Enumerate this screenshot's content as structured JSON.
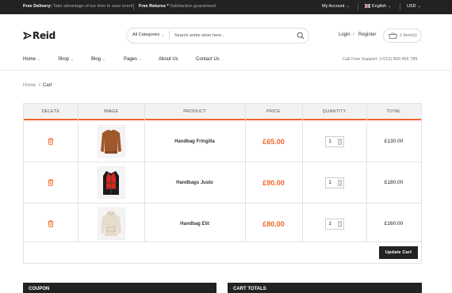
{
  "topbar": {
    "delivery_label": "Free Delivery:",
    "delivery_text": "Take advantage of our time to save event",
    "returns_label": "Free Returns *",
    "returns_text": "Satisfaction guaranteed",
    "account": "My Account",
    "language": "English",
    "currency": "USD"
  },
  "header": {
    "logo": "Reid",
    "search_category": "All Categories",
    "search_placeholder": "Search entire store here..",
    "login": "Login",
    "register": "Register",
    "account_sep": "/",
    "cart_count": "2 Item(s)"
  },
  "nav": {
    "items": [
      "Home",
      "Shop",
      "Blog",
      "Pages",
      "About Us",
      "Contact Us"
    ],
    "support": "Call Free Support: (+012) 800 456 789"
  },
  "breadcrumb": {
    "home": "Home",
    "sep": "/",
    "current": "Cart"
  },
  "cart": {
    "columns": [
      "Delete",
      "Image",
      "Product",
      "Price",
      "Quantity",
      "Total"
    ],
    "rows": [
      {
        "product": "Handbag Fringilla",
        "price": "£65.00",
        "qty": "1",
        "total": "£130.00",
        "image": "brown-jacket"
      },
      {
        "product": "Handbags Justo",
        "price": "£90.00",
        "qty": "1",
        "total": "£180.00",
        "image": "puffer-vest"
      },
      {
        "product": "Handbag Elit",
        "price": "£80.00",
        "qty": "1",
        "total": "£160.00",
        "image": "beige-hoodie"
      }
    ],
    "update_button": "Update Cart"
  },
  "panels": {
    "coupon": "Coupon",
    "totals": "Cart Totals"
  },
  "colors": {
    "accent": "#f0652a",
    "dark": "#222222"
  }
}
